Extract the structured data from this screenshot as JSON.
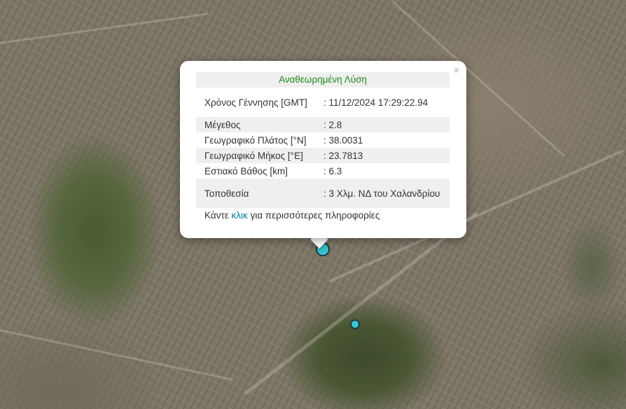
{
  "popup": {
    "close_symbol": "×",
    "title": "Αναθεωρημένη Λύση",
    "rows": [
      {
        "label": "Χρόνος Γέννησης [GMT]",
        "value": ": 11/12/2024 17:29:22.94"
      },
      {
        "label": "Μέγεθος",
        "value": ": 2.8"
      },
      {
        "label": "Γεωγραφικό Πλάτος [°N]",
        "value": ": 38.0031"
      },
      {
        "label": "Γεωγραφικό Μήκος [°E]",
        "value": ": 23.7813"
      },
      {
        "label": "Εστιακό Βάθος [km]",
        "value": ": 6.3"
      },
      {
        "label": "Τοποθεσία",
        "value": ": 3 Χλμ. ΝΔ του Χαλανδρίου"
      }
    ],
    "footer": {
      "prefix": "Κάντε ",
      "link_text": "κλικ",
      "suffix": " για περισσότερες πληροφορίες"
    }
  },
  "colors": {
    "title": "#1c8a1c",
    "link": "#0078a8",
    "marker_fill": "#3cc6d3",
    "marker_stroke": "#1c3a44"
  },
  "markers": [
    {
      "name": "selected-earthquake",
      "icon": "circle-marker"
    },
    {
      "name": "earthquake",
      "icon": "circle-marker"
    }
  ]
}
